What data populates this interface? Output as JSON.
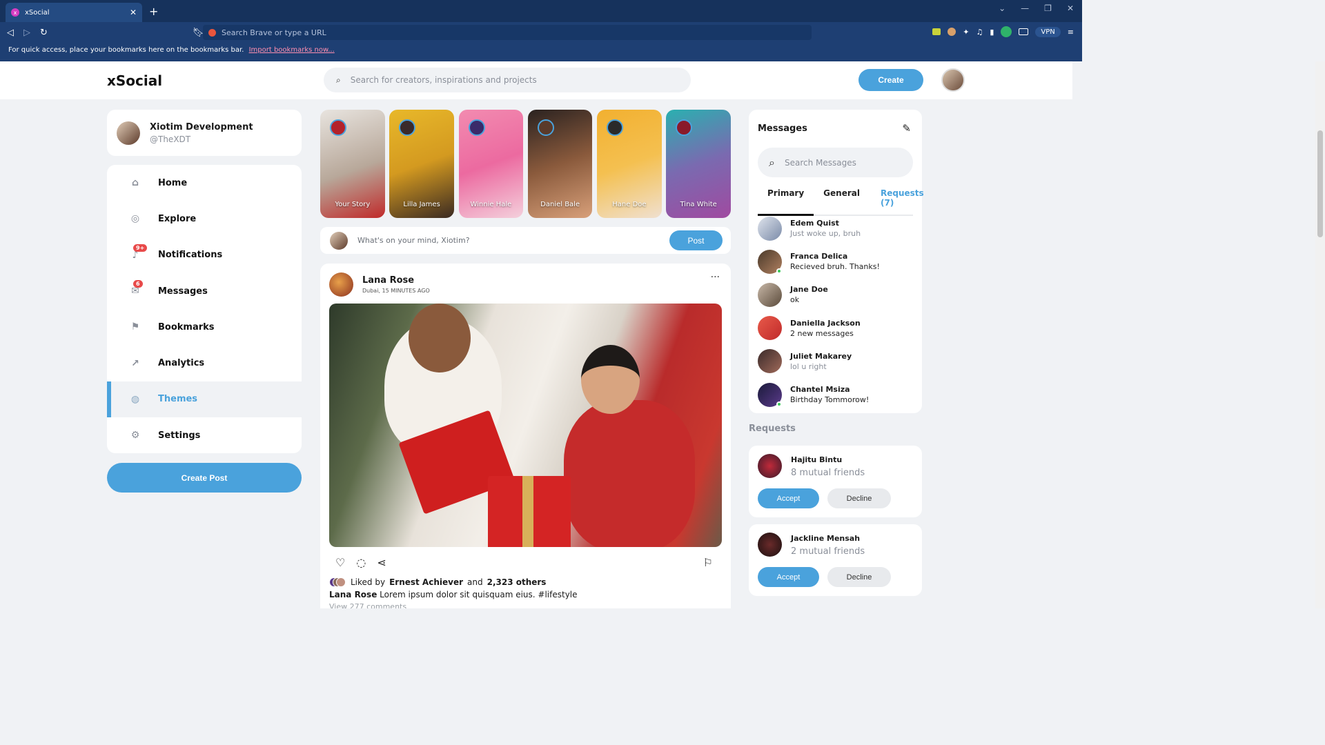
{
  "browser": {
    "tab_title": "xSocial",
    "address_placeholder": "Search Brave or type a URL",
    "vpn_label": "VPN",
    "bookmarks_hint": "For quick access, place your bookmarks here on the bookmarks bar.",
    "bookmarks_link": "Import bookmarks now..."
  },
  "header": {
    "logo": "xSocial",
    "search_placeholder": "Search for creators, inspirations and projects",
    "create_label": "Create"
  },
  "profile": {
    "name": "Xiotim Development",
    "handle": "@TheXDT"
  },
  "sidebar": {
    "items": [
      {
        "label": "Home",
        "icon": "home-icon"
      },
      {
        "label": "Explore",
        "icon": "compass-icon"
      },
      {
        "label": "Notifications",
        "icon": "bell-icon",
        "badge": "9+"
      },
      {
        "label": "Messages",
        "icon": "envelope-icon",
        "badge": "6"
      },
      {
        "label": "Bookmarks",
        "icon": "bookmark-icon"
      },
      {
        "label": "Analytics",
        "icon": "chart-icon"
      },
      {
        "label": "Themes",
        "icon": "palette-icon",
        "active": true
      },
      {
        "label": "Settings",
        "icon": "gear-icon"
      }
    ],
    "create_post_label": "Create Post"
  },
  "stories": [
    {
      "name": "Your Story"
    },
    {
      "name": "Lilla James"
    },
    {
      "name": "Winnie Hale"
    },
    {
      "name": "Daniel Bale"
    },
    {
      "name": "Hane Doe"
    },
    {
      "name": "Tina White"
    }
  ],
  "composer": {
    "placeholder": "What's on your mind, Xiotim?",
    "post_label": "Post"
  },
  "post": {
    "author": "Lana Rose",
    "meta": "Dubai, 15 MINUTES AGO",
    "liked_by_prefix": "Liked by",
    "liked_by_name": "Ernest Achiever",
    "liked_by_and": "and",
    "liked_by_others": "2,323 others",
    "caption_author": "Lana Rose",
    "caption_text": "Lorem ipsum dolor sit quisquam eius. #lifestyle",
    "comments_link": "View 277 comments"
  },
  "messages": {
    "title": "Messages",
    "search_placeholder": "Search Messages",
    "tabs": [
      "Primary",
      "General",
      "Requests (7)"
    ],
    "items": [
      {
        "name": "Edem Quist",
        "text": "Just woke up, bruh",
        "muted": true,
        "online": false
      },
      {
        "name": "Franca Delica",
        "text": "Recieved bruh. Thanks!",
        "muted": false,
        "online": true
      },
      {
        "name": "Jane Doe",
        "text": "ok",
        "muted": false,
        "online": false
      },
      {
        "name": "Daniella Jackson",
        "text": "2 new messages",
        "muted": false,
        "online": false
      },
      {
        "name": "Juliet Makarey",
        "text": "lol u right",
        "muted": true,
        "online": false
      },
      {
        "name": "Chantel Msiza",
        "text": "Birthday Tommorow!",
        "muted": false,
        "online": true
      }
    ]
  },
  "requests": {
    "heading": "Requests",
    "items": [
      {
        "name": "Hajitu Bintu",
        "mutual": "8 mutual friends",
        "accept": "Accept",
        "decline": "Decline"
      },
      {
        "name": "Jackline Mensah",
        "mutual": "2 mutual friends",
        "accept": "Accept",
        "decline": "Decline"
      }
    ]
  },
  "colors": {
    "accent": "#4aa2dc",
    "browser_chrome": "#1e3f73",
    "badge": "#e84a4a",
    "online": "#3cc95a"
  }
}
